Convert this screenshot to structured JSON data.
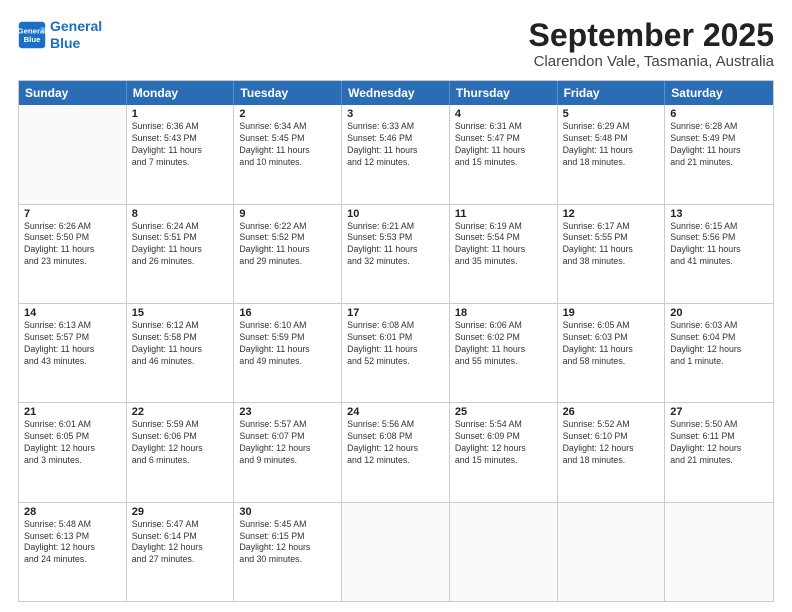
{
  "logo": {
    "line1": "General",
    "line2": "Blue"
  },
  "title": "September 2025",
  "subtitle": "Clarendon Vale, Tasmania, Australia",
  "header": {
    "days": [
      "Sunday",
      "Monday",
      "Tuesday",
      "Wednesday",
      "Thursday",
      "Friday",
      "Saturday"
    ]
  },
  "weeks": [
    [
      {
        "day": "",
        "info": ""
      },
      {
        "day": "1",
        "info": "Sunrise: 6:36 AM\nSunset: 5:43 PM\nDaylight: 11 hours\nand 7 minutes."
      },
      {
        "day": "2",
        "info": "Sunrise: 6:34 AM\nSunset: 5:45 PM\nDaylight: 11 hours\nand 10 minutes."
      },
      {
        "day": "3",
        "info": "Sunrise: 6:33 AM\nSunset: 5:46 PM\nDaylight: 11 hours\nand 12 minutes."
      },
      {
        "day": "4",
        "info": "Sunrise: 6:31 AM\nSunset: 5:47 PM\nDaylight: 11 hours\nand 15 minutes."
      },
      {
        "day": "5",
        "info": "Sunrise: 6:29 AM\nSunset: 5:48 PM\nDaylight: 11 hours\nand 18 minutes."
      },
      {
        "day": "6",
        "info": "Sunrise: 6:28 AM\nSunset: 5:49 PM\nDaylight: 11 hours\nand 21 minutes."
      }
    ],
    [
      {
        "day": "7",
        "info": "Sunrise: 6:26 AM\nSunset: 5:50 PM\nDaylight: 11 hours\nand 23 minutes."
      },
      {
        "day": "8",
        "info": "Sunrise: 6:24 AM\nSunset: 5:51 PM\nDaylight: 11 hours\nand 26 minutes."
      },
      {
        "day": "9",
        "info": "Sunrise: 6:22 AM\nSunset: 5:52 PM\nDaylight: 11 hours\nand 29 minutes."
      },
      {
        "day": "10",
        "info": "Sunrise: 6:21 AM\nSunset: 5:53 PM\nDaylight: 11 hours\nand 32 minutes."
      },
      {
        "day": "11",
        "info": "Sunrise: 6:19 AM\nSunset: 5:54 PM\nDaylight: 11 hours\nand 35 minutes."
      },
      {
        "day": "12",
        "info": "Sunrise: 6:17 AM\nSunset: 5:55 PM\nDaylight: 11 hours\nand 38 minutes."
      },
      {
        "day": "13",
        "info": "Sunrise: 6:15 AM\nSunset: 5:56 PM\nDaylight: 11 hours\nand 41 minutes."
      }
    ],
    [
      {
        "day": "14",
        "info": "Sunrise: 6:13 AM\nSunset: 5:57 PM\nDaylight: 11 hours\nand 43 minutes."
      },
      {
        "day": "15",
        "info": "Sunrise: 6:12 AM\nSunset: 5:58 PM\nDaylight: 11 hours\nand 46 minutes."
      },
      {
        "day": "16",
        "info": "Sunrise: 6:10 AM\nSunset: 5:59 PM\nDaylight: 11 hours\nand 49 minutes."
      },
      {
        "day": "17",
        "info": "Sunrise: 6:08 AM\nSunset: 6:01 PM\nDaylight: 11 hours\nand 52 minutes."
      },
      {
        "day": "18",
        "info": "Sunrise: 6:06 AM\nSunset: 6:02 PM\nDaylight: 11 hours\nand 55 minutes."
      },
      {
        "day": "19",
        "info": "Sunrise: 6:05 AM\nSunset: 6:03 PM\nDaylight: 11 hours\nand 58 minutes."
      },
      {
        "day": "20",
        "info": "Sunrise: 6:03 AM\nSunset: 6:04 PM\nDaylight: 12 hours\nand 1 minute."
      }
    ],
    [
      {
        "day": "21",
        "info": "Sunrise: 6:01 AM\nSunset: 6:05 PM\nDaylight: 12 hours\nand 3 minutes."
      },
      {
        "day": "22",
        "info": "Sunrise: 5:59 AM\nSunset: 6:06 PM\nDaylight: 12 hours\nand 6 minutes."
      },
      {
        "day": "23",
        "info": "Sunrise: 5:57 AM\nSunset: 6:07 PM\nDaylight: 12 hours\nand 9 minutes."
      },
      {
        "day": "24",
        "info": "Sunrise: 5:56 AM\nSunset: 6:08 PM\nDaylight: 12 hours\nand 12 minutes."
      },
      {
        "day": "25",
        "info": "Sunrise: 5:54 AM\nSunset: 6:09 PM\nDaylight: 12 hours\nand 15 minutes."
      },
      {
        "day": "26",
        "info": "Sunrise: 5:52 AM\nSunset: 6:10 PM\nDaylight: 12 hours\nand 18 minutes."
      },
      {
        "day": "27",
        "info": "Sunrise: 5:50 AM\nSunset: 6:11 PM\nDaylight: 12 hours\nand 21 minutes."
      }
    ],
    [
      {
        "day": "28",
        "info": "Sunrise: 5:48 AM\nSunset: 6:13 PM\nDaylight: 12 hours\nand 24 minutes."
      },
      {
        "day": "29",
        "info": "Sunrise: 5:47 AM\nSunset: 6:14 PM\nDaylight: 12 hours\nand 27 minutes."
      },
      {
        "day": "30",
        "info": "Sunrise: 5:45 AM\nSunset: 6:15 PM\nDaylight: 12 hours\nand 30 minutes."
      },
      {
        "day": "",
        "info": ""
      },
      {
        "day": "",
        "info": ""
      },
      {
        "day": "",
        "info": ""
      },
      {
        "day": "",
        "info": ""
      }
    ]
  ]
}
